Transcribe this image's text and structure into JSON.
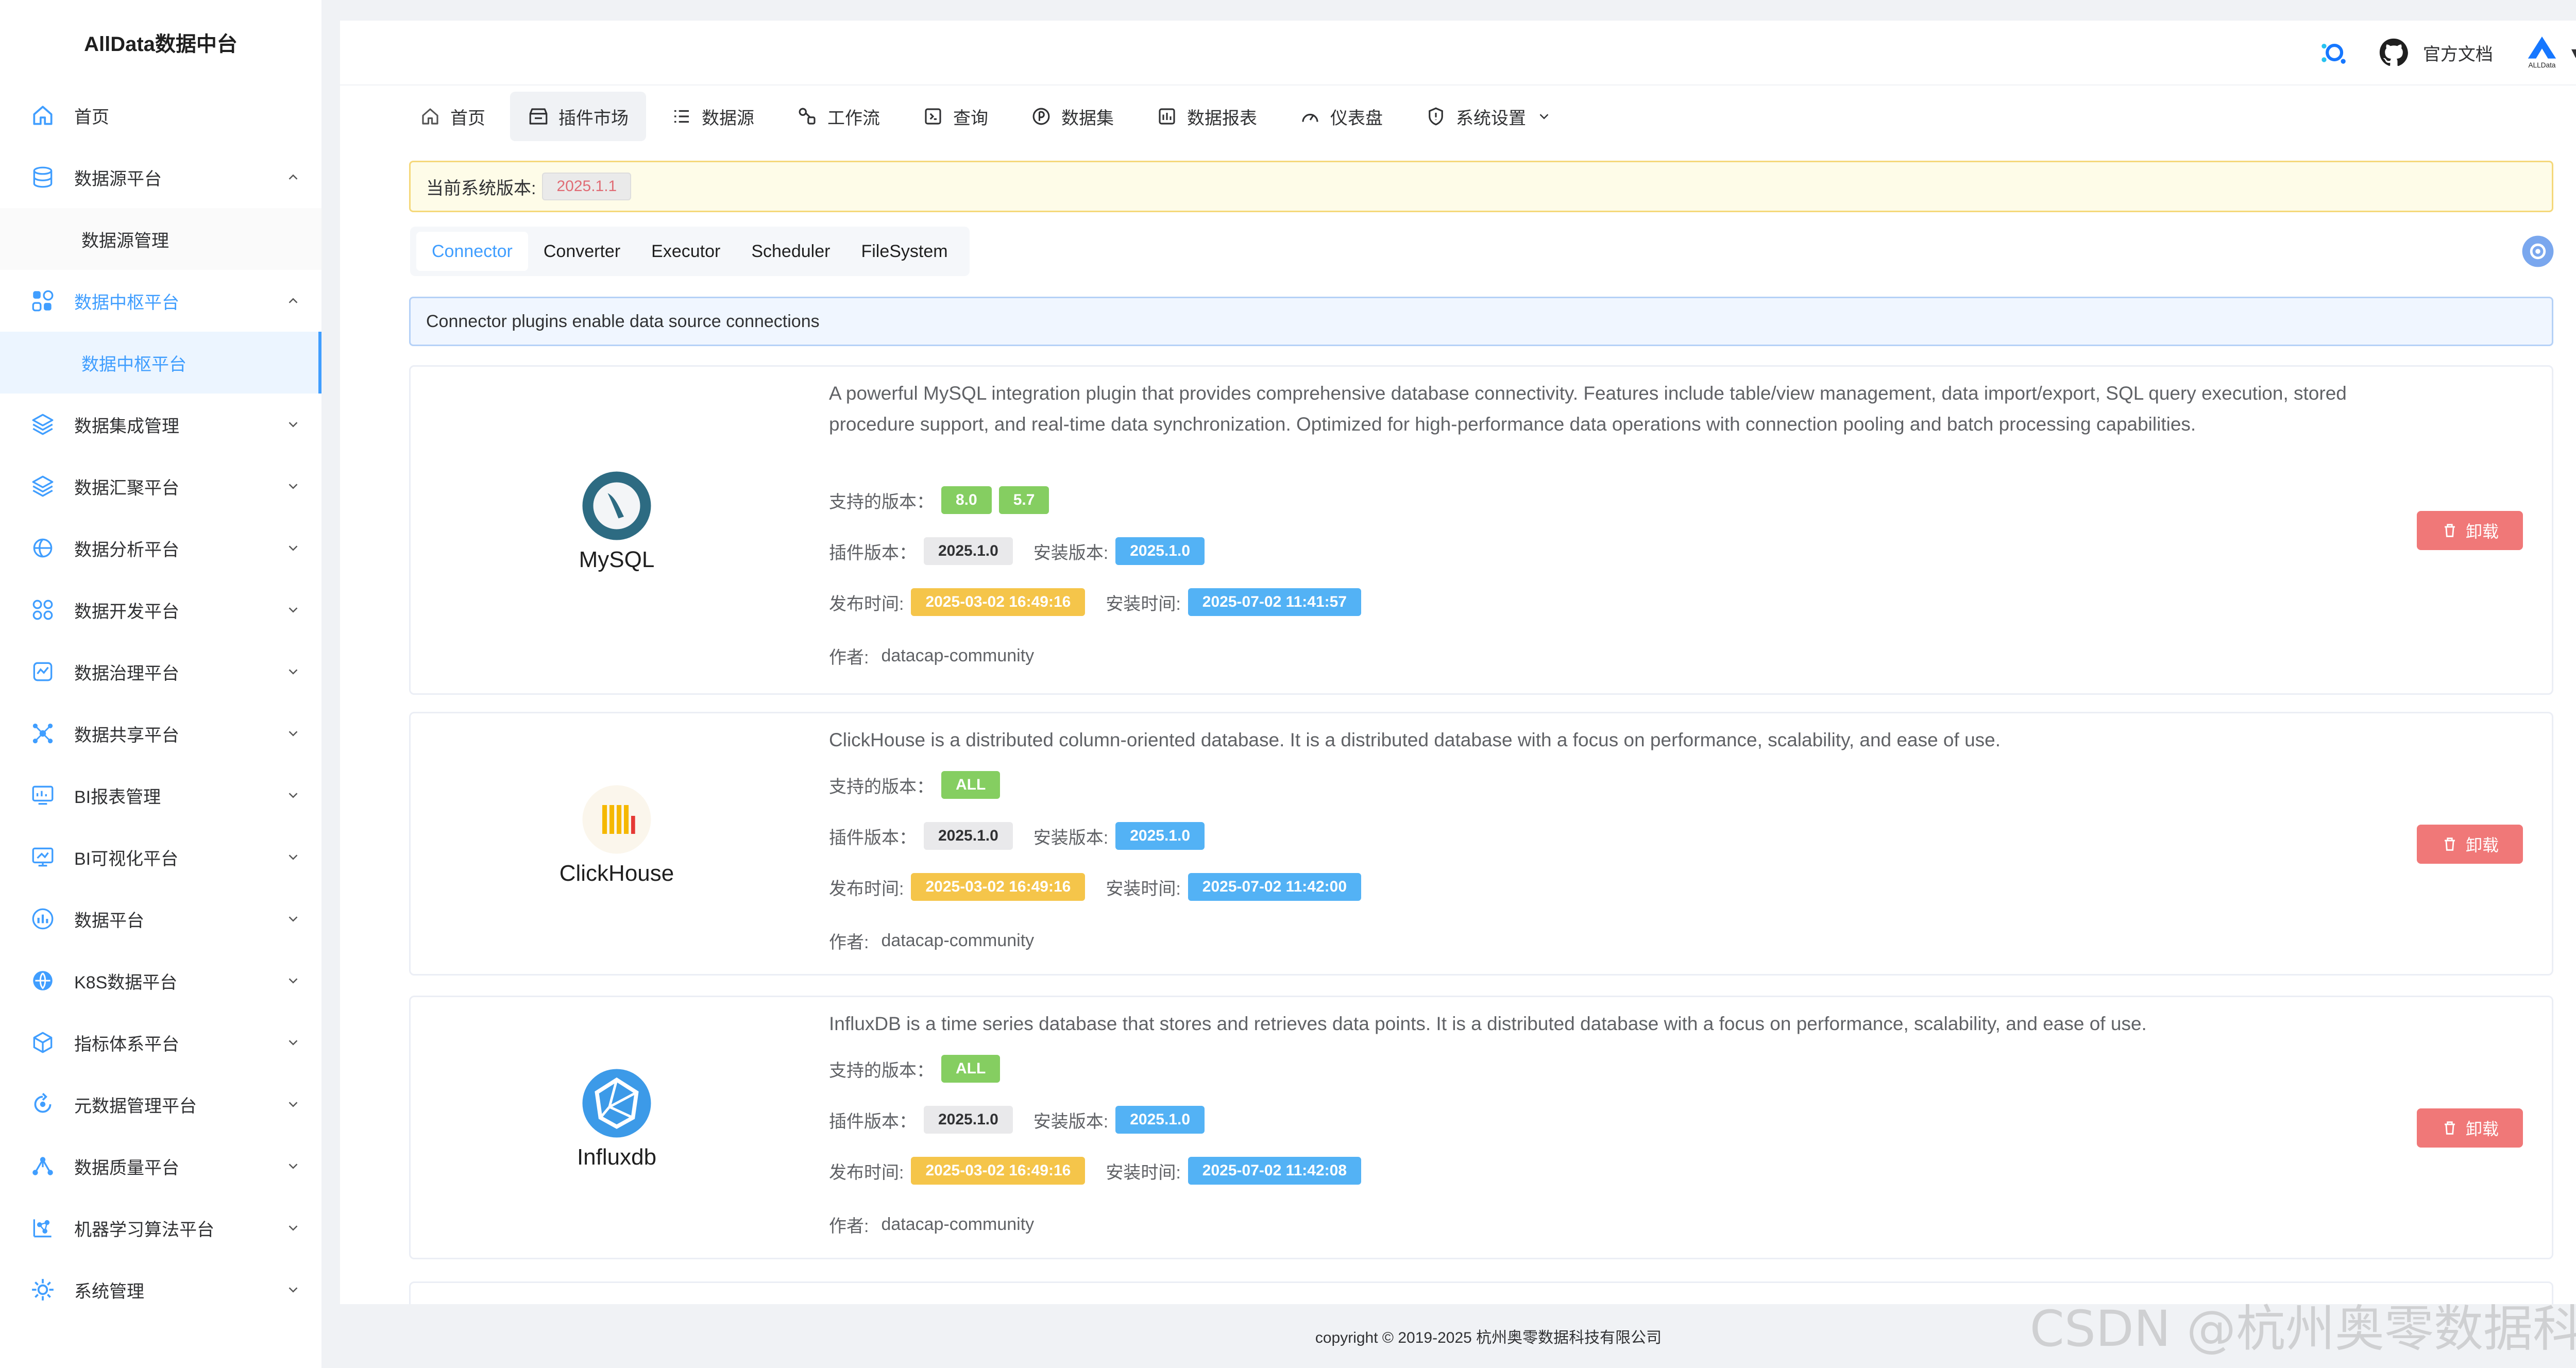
{
  "brand": "AllData数据中台",
  "sidebar": {
    "items": [
      {
        "label": "首页",
        "icon": "home-icon"
      },
      {
        "label": "数据源平台",
        "icon": "database-icon",
        "expanded": true
      },
      {
        "label": "数据源管理",
        "sub": true
      },
      {
        "label": "数据中枢平台",
        "icon": "hub-icon",
        "expanded": true,
        "active": true
      },
      {
        "label": "数据中枢平台",
        "sub": true,
        "active": true
      },
      {
        "label": "数据集成管理",
        "icon": "layers-icon"
      },
      {
        "label": "数据汇聚平台",
        "icon": "layers-icon"
      },
      {
        "label": "数据分析平台",
        "icon": "analysis-icon"
      },
      {
        "label": "数据开发平台",
        "icon": "grid-icon"
      },
      {
        "label": "数据治理平台",
        "icon": "governance-icon"
      },
      {
        "label": "数据共享平台",
        "icon": "share-icon"
      },
      {
        "label": "BI报表管理",
        "icon": "bi-report-icon"
      },
      {
        "label": "BI可视化平台",
        "icon": "bi-visual-icon"
      },
      {
        "label": "数据平台",
        "icon": "platform-icon"
      },
      {
        "label": "K8S数据平台",
        "icon": "k8s-icon"
      },
      {
        "label": "指标体系平台",
        "icon": "cube-icon"
      },
      {
        "label": "元数据管理平台",
        "icon": "metadata-icon"
      },
      {
        "label": "数据质量平台",
        "icon": "quality-icon"
      },
      {
        "label": "机器学习算法平台",
        "icon": "ml-icon"
      },
      {
        "label": "系统管理",
        "icon": "system-icon"
      }
    ]
  },
  "header": {
    "docs_label": "官方文档",
    "logo_text": "ALLData",
    "dropdown_arrow": "▾"
  },
  "topnav": {
    "items": [
      {
        "label": "首页",
        "icon": "home-icon"
      },
      {
        "label": "插件市场",
        "icon": "store-icon",
        "active": true
      },
      {
        "label": "数据源",
        "icon": "list-icon"
      },
      {
        "label": "工作流",
        "icon": "workflow-icon"
      },
      {
        "label": "查询",
        "icon": "query-icon"
      },
      {
        "label": "数据集",
        "icon": "dataset-icon"
      },
      {
        "label": "数据报表",
        "icon": "report-icon"
      },
      {
        "label": "仪表盘",
        "icon": "dashboard-icon"
      },
      {
        "label": "系统设置",
        "icon": "shield-icon",
        "has_dropdown": true
      }
    ]
  },
  "version": {
    "label": "当前系统版本:",
    "value": "2025.1.1"
  },
  "tabs": [
    "Connector",
    "Converter",
    "Executor",
    "Scheduler",
    "FileSystem"
  ],
  "active_tab": "Connector",
  "info": "Connector plugins enable data source connections",
  "labels": {
    "supported": "支持的版本：",
    "plugin_version": "插件版本：",
    "install_version": "安装版本:",
    "release_time": "发布时间:",
    "install_time": "安装时间:",
    "author": "作者:",
    "unload": "卸载"
  },
  "plugins": [
    {
      "name": "MySQL",
      "description": "A powerful MySQL integration plugin that provides comprehensive database connectivity. Features include table/view management, data import/export, SQL query execution, stored procedure support, and real-time data synchronization. Optimized for high-performance data operations with connection pooling and batch processing capabilities.",
      "supported_versions": [
        "8.0",
        "5.7"
      ],
      "plugin_version": "2025.1.0",
      "install_version": "2025.1.0",
      "release_time": "2025-03-02 16:49:16",
      "install_time": "2025-07-02 11:41:57",
      "author": "datacap-community"
    },
    {
      "name": "ClickHouse",
      "description": "ClickHouse is a distributed column-oriented database. It is a distributed database with a focus on performance, scalability, and ease of use.",
      "supported_versions": [
        "ALL"
      ],
      "plugin_version": "2025.1.0",
      "install_version": "2025.1.0",
      "release_time": "2025-03-02 16:49:16",
      "install_time": "2025-07-02 11:42:00",
      "author": "datacap-community"
    },
    {
      "name": "Influxdb",
      "description": "InfluxDB is a time series database that stores and retrieves data points. It is a distributed database with a focus on performance, scalability, and ease of use.",
      "supported_versions": [
        "ALL"
      ],
      "plugin_version": "2025.1.0",
      "install_version": "2025.1.0",
      "release_time": "2025-03-02 16:49:16",
      "install_time": "2025-07-02 11:42:08",
      "author": "datacap-community"
    }
  ],
  "footer": "copyright © 2019-2025 杭州奥零数据科技有限公司",
  "watermark": "CSDN @杭州奥零数据科技",
  "colors": {
    "accent": "#409eff",
    "unload": "#f07878"
  }
}
